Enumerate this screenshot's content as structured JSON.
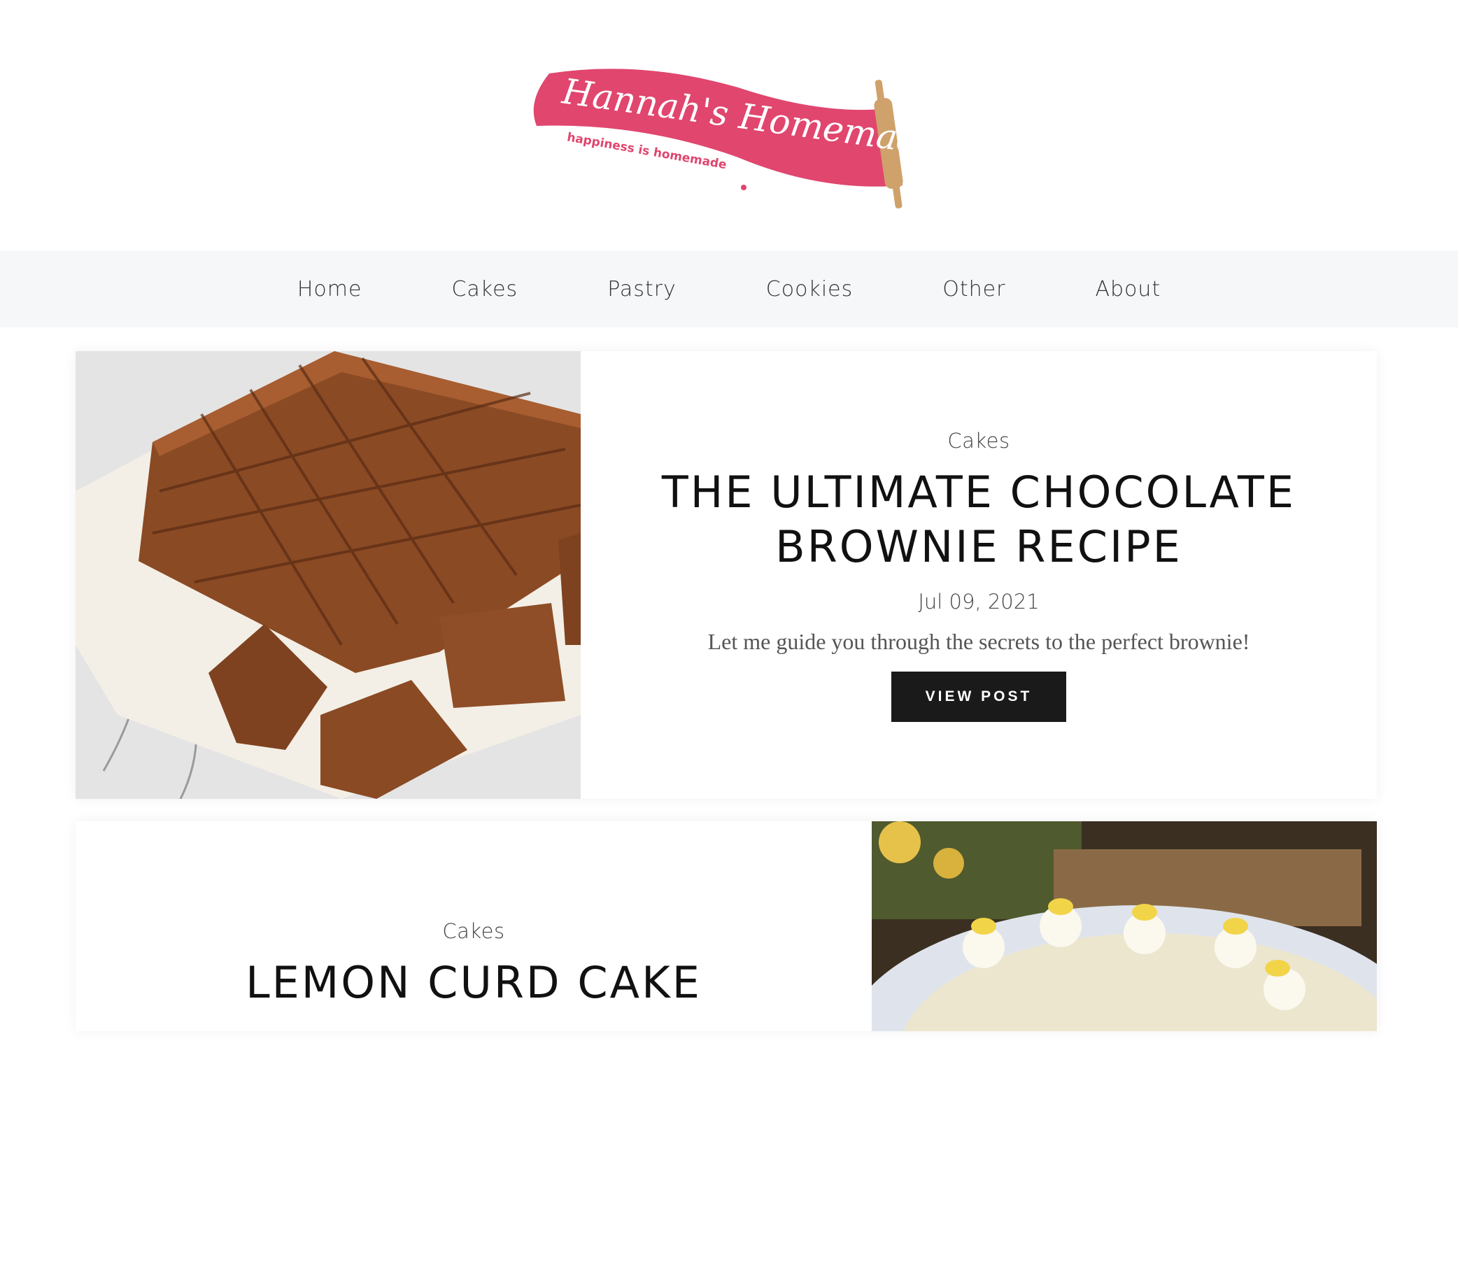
{
  "brand": {
    "name": "Hannah's Homemade",
    "tagline": "happiness is homemade",
    "accent": "#e0466e"
  },
  "nav": {
    "items": [
      {
        "label": "Home"
      },
      {
        "label": "Cakes"
      },
      {
        "label": "Pastry"
      },
      {
        "label": "Cookies"
      },
      {
        "label": "Other"
      },
      {
        "label": "About"
      }
    ]
  },
  "posts": [
    {
      "category": "Cakes",
      "title": "THE ULTIMATE CHOCOLATE BROWNIE RECIPE",
      "date": "Jul 09, 2021",
      "excerpt": "Let me guide you through the secrets to the perfect brownie!",
      "button_label": "VIEW POST",
      "image": "brownies-photo"
    },
    {
      "category": "Cakes",
      "title": "LEMON CURD CAKE",
      "image": "lemon-curd-cake-photo"
    }
  ],
  "colors": {
    "nav_bg": "#f6f7f9",
    "button_bg": "#1a1a1a"
  }
}
